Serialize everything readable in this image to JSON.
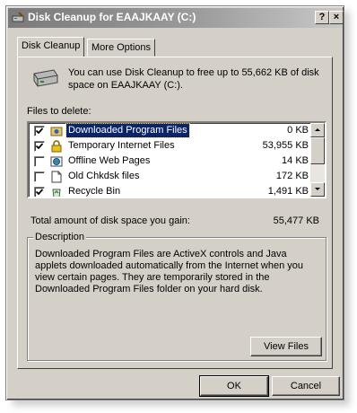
{
  "window": {
    "title": "Disk Cleanup for EAAJKAAY (C:)",
    "help_button": "?",
    "close_button": "×"
  },
  "tabs": [
    {
      "label": "Disk Cleanup",
      "active": true
    },
    {
      "label": "More Options",
      "active": false
    }
  ],
  "intro": {
    "text": "You can use Disk Cleanup to free up to 55,662 KB of disk space on EAAJKAAY (C:).",
    "icon": "drive-icon"
  },
  "files": {
    "label": "Files to delete:",
    "items": [
      {
        "name": "Downloaded Program Files",
        "size": "0 KB",
        "checked": true,
        "selected": true,
        "icon": "program-files-icon"
      },
      {
        "name": "Temporary Internet Files",
        "size": "53,955 KB",
        "checked": true,
        "selected": false,
        "icon": "lock-icon"
      },
      {
        "name": "Offline Web Pages",
        "size": "14 KB",
        "checked": false,
        "selected": false,
        "icon": "offline-pages-icon"
      },
      {
        "name": "Old Chkdsk files",
        "size": "172 KB",
        "checked": false,
        "selected": false,
        "icon": "document-icon"
      },
      {
        "name": "Recycle Bin",
        "size": "1,491 KB",
        "checked": true,
        "selected": false,
        "icon": "recycle-bin-icon"
      }
    ]
  },
  "total": {
    "label": "Total amount of disk space you gain:",
    "value": "55,477 KB"
  },
  "description": {
    "title": "Description",
    "text": "Downloaded Program Files are ActiveX controls and Java applets downloaded automatically from the Internet when you view certain pages. They are temporarily stored in the Downloaded Program Files folder on your hard disk."
  },
  "buttons": {
    "view_files": "View Files",
    "ok": "OK",
    "cancel": "Cancel"
  },
  "colors": {
    "face": "#d4d0c8",
    "selection": "#0a246a"
  }
}
